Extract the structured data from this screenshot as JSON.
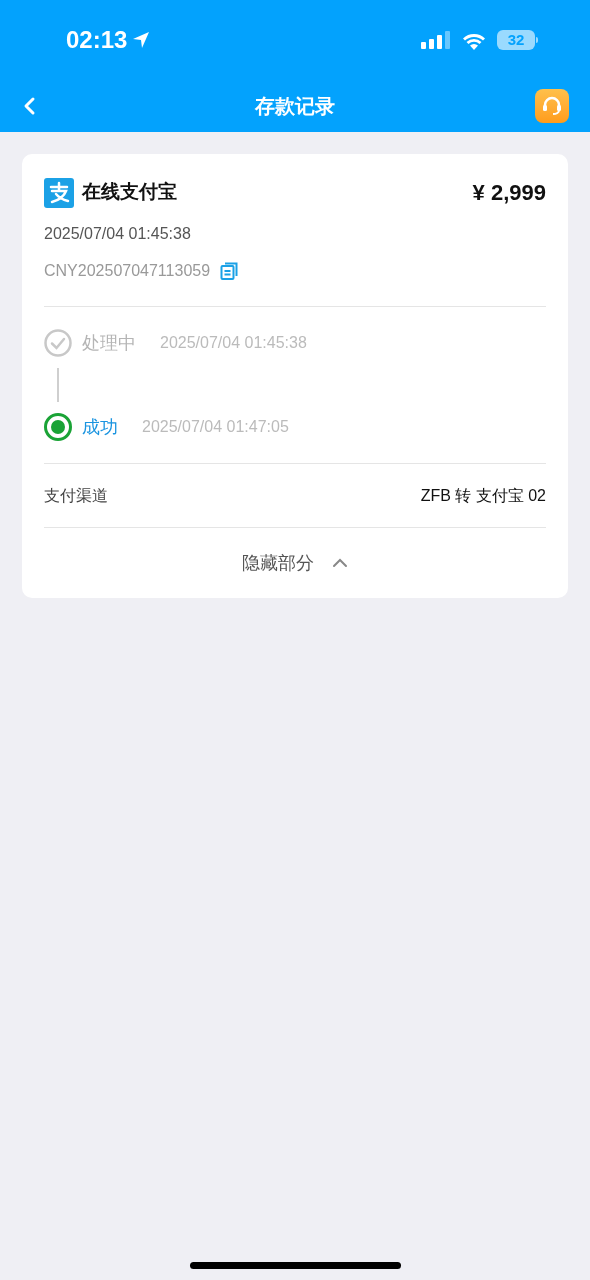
{
  "status_bar": {
    "time": "02:13",
    "battery": "32"
  },
  "nav": {
    "title": "存款记录"
  },
  "record": {
    "method": "在线支付宝",
    "amount": "¥ 2,999",
    "time": "2025/07/04 01:45:38",
    "order_no": "CNY202507047113059",
    "steps": [
      {
        "kind": "past",
        "label": "处理中",
        "time": "2025/07/04 01:45:38"
      },
      {
        "kind": "current",
        "label": "成功",
        "time": "2025/07/04 01:47:05"
      }
    ],
    "channel": {
      "label": "支付渠道",
      "value": "ZFB 转 支付宝 02"
    },
    "toggle": {
      "label": "隐藏部分",
      "expanded": true
    }
  }
}
